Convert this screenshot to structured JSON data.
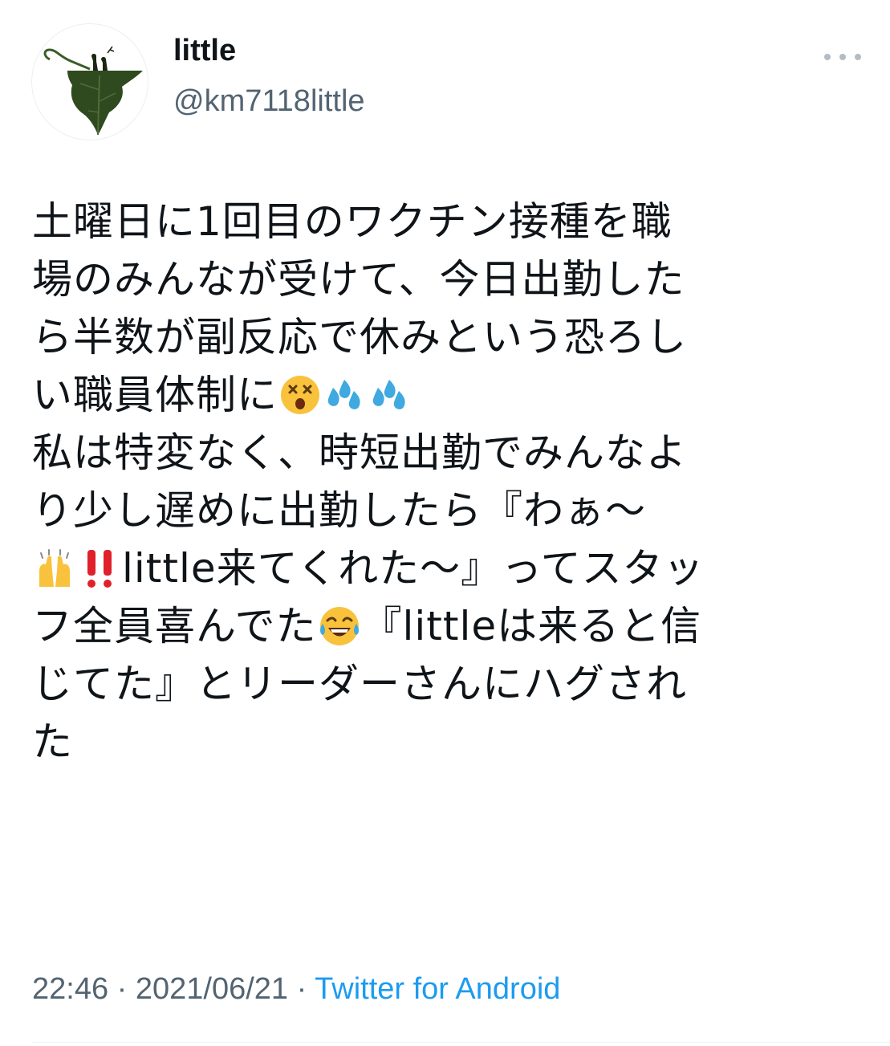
{
  "user": {
    "display_name": "little",
    "handle": "@km7118little",
    "avatar_icon": "ivy-leaf-avatar-icon"
  },
  "tweet": {
    "lines": [
      [
        "土曜日に1回目のワクチン接種を職"
      ],
      [
        "場のみんなが受けて、今日出勤した"
      ],
      [
        "ら半数が副反応で休みという恐ろし"
      ],
      [
        "い職員体制に"
      ],
      [
        "私は特変なく、時短出勤でみんなよ"
      ],
      [
        "り少し遅めに出勤したら『わぁ〜"
      ],
      [
        "little来てくれた〜』ってスタッ"
      ],
      [
        "フ全員喜んでた",
        "『littleは来ると信"
      ],
      [
        "じてた』とリーダーさんにハグされ"
      ],
      [
        "た"
      ]
    ],
    "emojis": {
      "line4": [
        "dizzy-face-emoji",
        "sweat-droplets-emoji",
        "sweat-droplets-emoji"
      ],
      "line7": [
        "raising-hands-emoji",
        "double-exclamation-emoji"
      ],
      "line8": [
        "tears-of-joy-emoji"
      ]
    }
  },
  "meta": {
    "time": "22:46",
    "separator": " · ",
    "date": "2021/06/21",
    "source": "Twitter for Android"
  },
  "colors": {
    "text": "#0f1419",
    "secondary": "#536471",
    "link": "#1d9bf0"
  }
}
